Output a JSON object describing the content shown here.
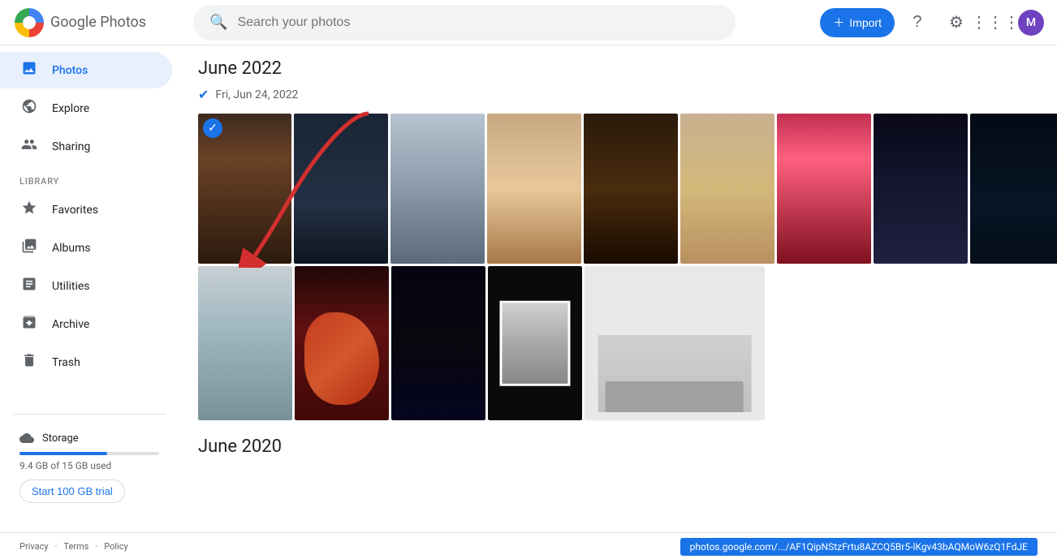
{
  "header": {
    "logo_text": "Google Photos",
    "search_placeholder": "Search your photos",
    "import_label": "Import"
  },
  "sidebar": {
    "nav_items": [
      {
        "id": "photos",
        "label": "Photos",
        "active": true
      },
      {
        "id": "explore",
        "label": "Explore",
        "active": false
      },
      {
        "id": "sharing",
        "label": "Sharing",
        "active": false
      }
    ],
    "library_label": "LIBRARY",
    "library_items": [
      {
        "id": "favorites",
        "label": "Favorites"
      },
      {
        "id": "albums",
        "label": "Albums"
      },
      {
        "id": "utilities",
        "label": "Utilities"
      },
      {
        "id": "archive",
        "label": "Archive"
      },
      {
        "id": "trash",
        "label": "Trash"
      }
    ],
    "storage": {
      "label": "Storage",
      "used": "9.4 GB of 15 GB used",
      "trial_btn": "Start 100 GB trial",
      "percent": 62.7
    }
  },
  "main": {
    "section1": {
      "title": "June 2022",
      "date": "Fri, Jun 24, 2022"
    },
    "section2": {
      "title": "June 2020"
    }
  },
  "footer": {
    "privacy": "Privacy",
    "terms": "Terms",
    "policy": "Policy",
    "url": "photos.google.com/.../AF1QipNStzFrtu8AZCQ5Br5-lKgv43bAQMoW6zQ1FdJE"
  }
}
